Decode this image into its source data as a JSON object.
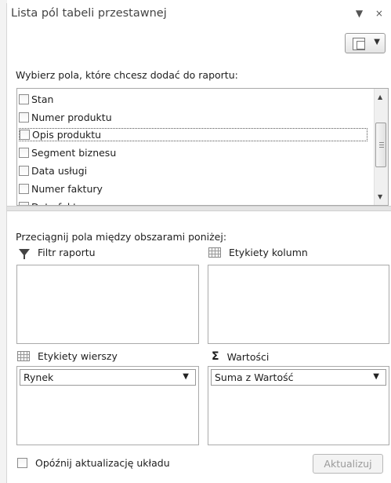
{
  "panel": {
    "title": "Lista pól tabeli przestawnej",
    "title_controls": "▼ ×",
    "choose_prompt": "Wybierz pola, które chcesz dodać do raportu:",
    "layout_button_arrow": "▼"
  },
  "fields": [
    {
      "label": "Stan",
      "checked": false
    },
    {
      "label": "Numer produktu",
      "checked": false
    },
    {
      "label": "Opis produktu",
      "checked": false,
      "focused": true
    },
    {
      "label": "Segment biznesu",
      "checked": false
    },
    {
      "label": "Data usługi",
      "checked": false
    },
    {
      "label": "Numer faktury",
      "checked": false
    },
    {
      "label": "Data faktury",
      "checked": false
    }
  ],
  "areas": {
    "drag_prompt": "Przeciągnij pola między obszarami poniżej:",
    "report_filter": {
      "label": "Filtr raportu",
      "icon": "funnel-icon"
    },
    "column_labels": {
      "label": "Etykiety kolumn",
      "icon": "grid-icon"
    },
    "row_labels": {
      "label": "Etykiety wierszy",
      "icon": "grid-icon",
      "value": "Rynek"
    },
    "values": {
      "label": "Wartości",
      "icon": "sigma-icon",
      "value": "Suma z Wartość"
    }
  },
  "footer": {
    "defer_label": "Opóźnij aktualizację układu",
    "update_button": "Aktualizuj"
  },
  "scrollbar": {
    "up": "▲",
    "down": "▼"
  },
  "dropdown_arrow": "▼"
}
